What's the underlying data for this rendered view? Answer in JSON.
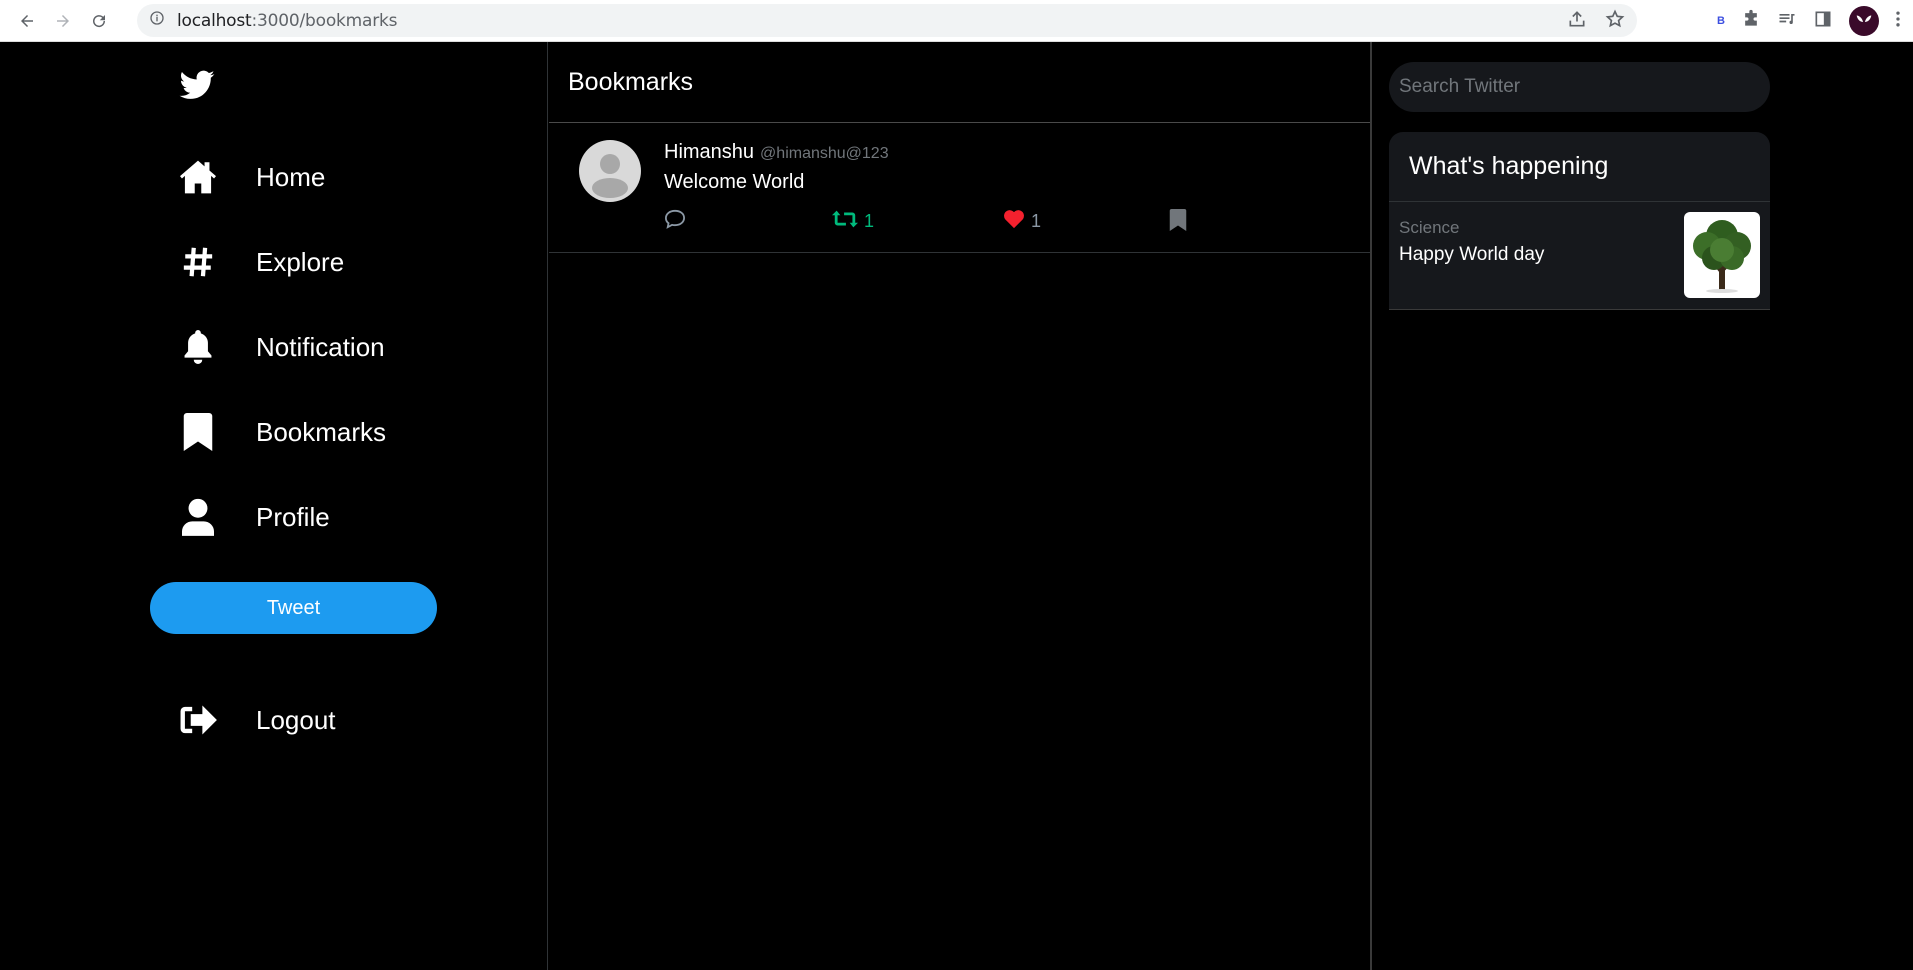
{
  "browser": {
    "url_host": "localhost",
    "url_path": ":3000/bookmarks",
    "extension_label": "B"
  },
  "sidebar": {
    "items": [
      {
        "label": "Home",
        "icon": "home-icon"
      },
      {
        "label": "Explore",
        "icon": "hashtag-icon"
      },
      {
        "label": "Notification",
        "icon": "bell-icon"
      },
      {
        "label": "Bookmarks",
        "icon": "bookmark-icon"
      },
      {
        "label": "Profile",
        "icon": "user-icon"
      }
    ],
    "tweet_button": "Tweet",
    "logout": "Logout"
  },
  "main": {
    "title": "Bookmarks",
    "tweets": [
      {
        "name": "Himanshu",
        "handle": "@himanshu@123",
        "text": "Welcome World",
        "retweets": "1",
        "likes": "1"
      }
    ]
  },
  "right": {
    "search_placeholder": "Search Twitter",
    "trends_title": "What's happening",
    "trends": [
      {
        "category": "Science",
        "title": "Happy World day",
        "image": "tree-image"
      }
    ]
  },
  "colors": {
    "accent": "#1d9bf0",
    "retweet": "#00ba7c",
    "like": "#f91880",
    "background": "#000000"
  }
}
